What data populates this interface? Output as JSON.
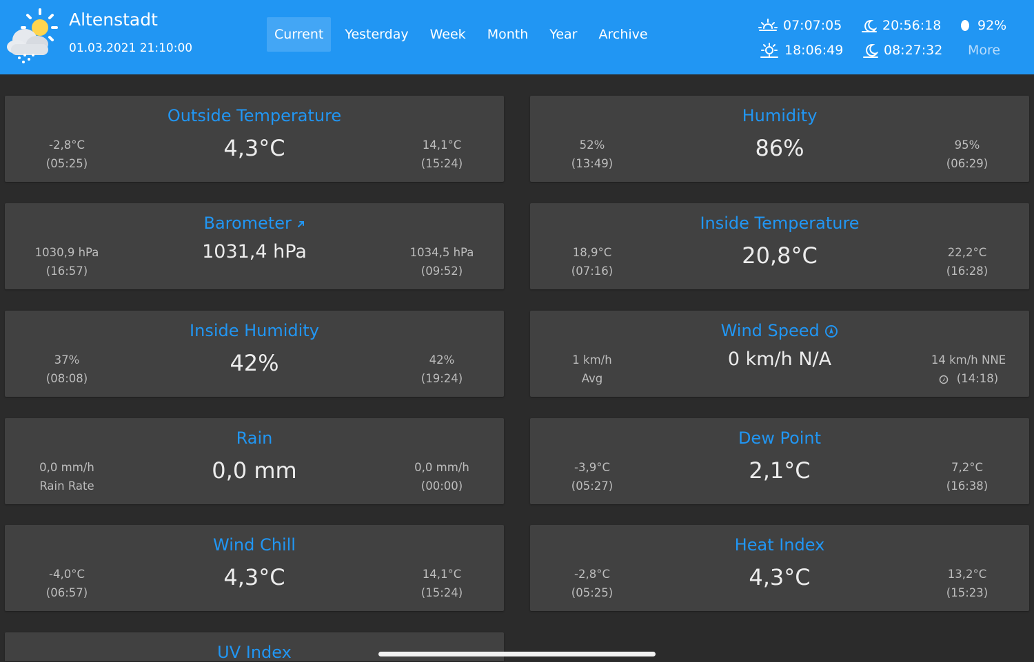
{
  "header": {
    "station": "Altenstadt",
    "datetime": "01.03.2021 21:10:00",
    "nav": [
      "Current",
      "Yesterday",
      "Week",
      "Month",
      "Year",
      "Archive"
    ],
    "active_nav": "Current",
    "almanac": {
      "sunrise": "07:07:05",
      "moonrise": "20:56:18",
      "moon_phase": "92%",
      "sunset": "18:06:49",
      "moonset": "08:27:32",
      "more": "More"
    }
  },
  "cards": {
    "outside_temp": {
      "title": "Outside Temperature",
      "value": "4,3°C",
      "min": "-2,8°C",
      "min_time": "(05:25)",
      "max": "14,1°C",
      "max_time": "(15:24)"
    },
    "humidity": {
      "title": "Humidity",
      "value": "86%",
      "min": "52%",
      "min_time": "(13:49)",
      "max": "95%",
      "max_time": "(06:29)"
    },
    "barometer": {
      "title": "Barometer",
      "trend_icon": "arrow-up-right-icon",
      "value": "1031,4 hPa",
      "min": "1030,9 hPa",
      "min_time": "(16:57)",
      "max": "1034,5 hPa",
      "max_time": "(09:52)"
    },
    "inside_temp": {
      "title": "Inside Temperature",
      "value": "20,8°C",
      "min": "18,9°C",
      "min_time": "(07:16)",
      "max": "22,2°C",
      "max_time": "(16:28)"
    },
    "inside_humidity": {
      "title": "Inside Humidity",
      "value": "42%",
      "min": "37%",
      "min_time": "(08:08)",
      "max": "42%",
      "max_time": "(19:24)"
    },
    "wind_speed": {
      "title": "Wind Speed",
      "value": "0 km/h N/A",
      "avg": "1 km/h",
      "avg_label": "Avg",
      "max": "14 km/h NNE",
      "max_time": "(14:18)"
    },
    "rain": {
      "title": "Rain",
      "value": "0,0 mm",
      "rate": "0,0 mm/h",
      "rate_label": "Rain Rate",
      "max": "0,0 mm/h",
      "max_time": "(00:00)"
    },
    "dew_point": {
      "title": "Dew Point",
      "value": "2,1°C",
      "min": "-3,9°C",
      "min_time": "(05:27)",
      "max": "7,2°C",
      "max_time": "(16:38)"
    },
    "wind_chill": {
      "title": "Wind Chill",
      "value": "4,3°C",
      "min": "-4,0°C",
      "min_time": "(06:57)",
      "max": "14,1°C",
      "max_time": "(15:24)"
    },
    "heat_index": {
      "title": "Heat Index",
      "value": "4,3°C",
      "min": "-2,8°C",
      "min_time": "(05:25)",
      "max": "13,2°C",
      "max_time": "(15:23)"
    },
    "uv_index": {
      "title": "UV Index"
    }
  },
  "colors": {
    "header_bg": "#2196f3",
    "accent": "#2196f3",
    "card_bg": "#414141",
    "page_bg": "#2b2b2b"
  }
}
